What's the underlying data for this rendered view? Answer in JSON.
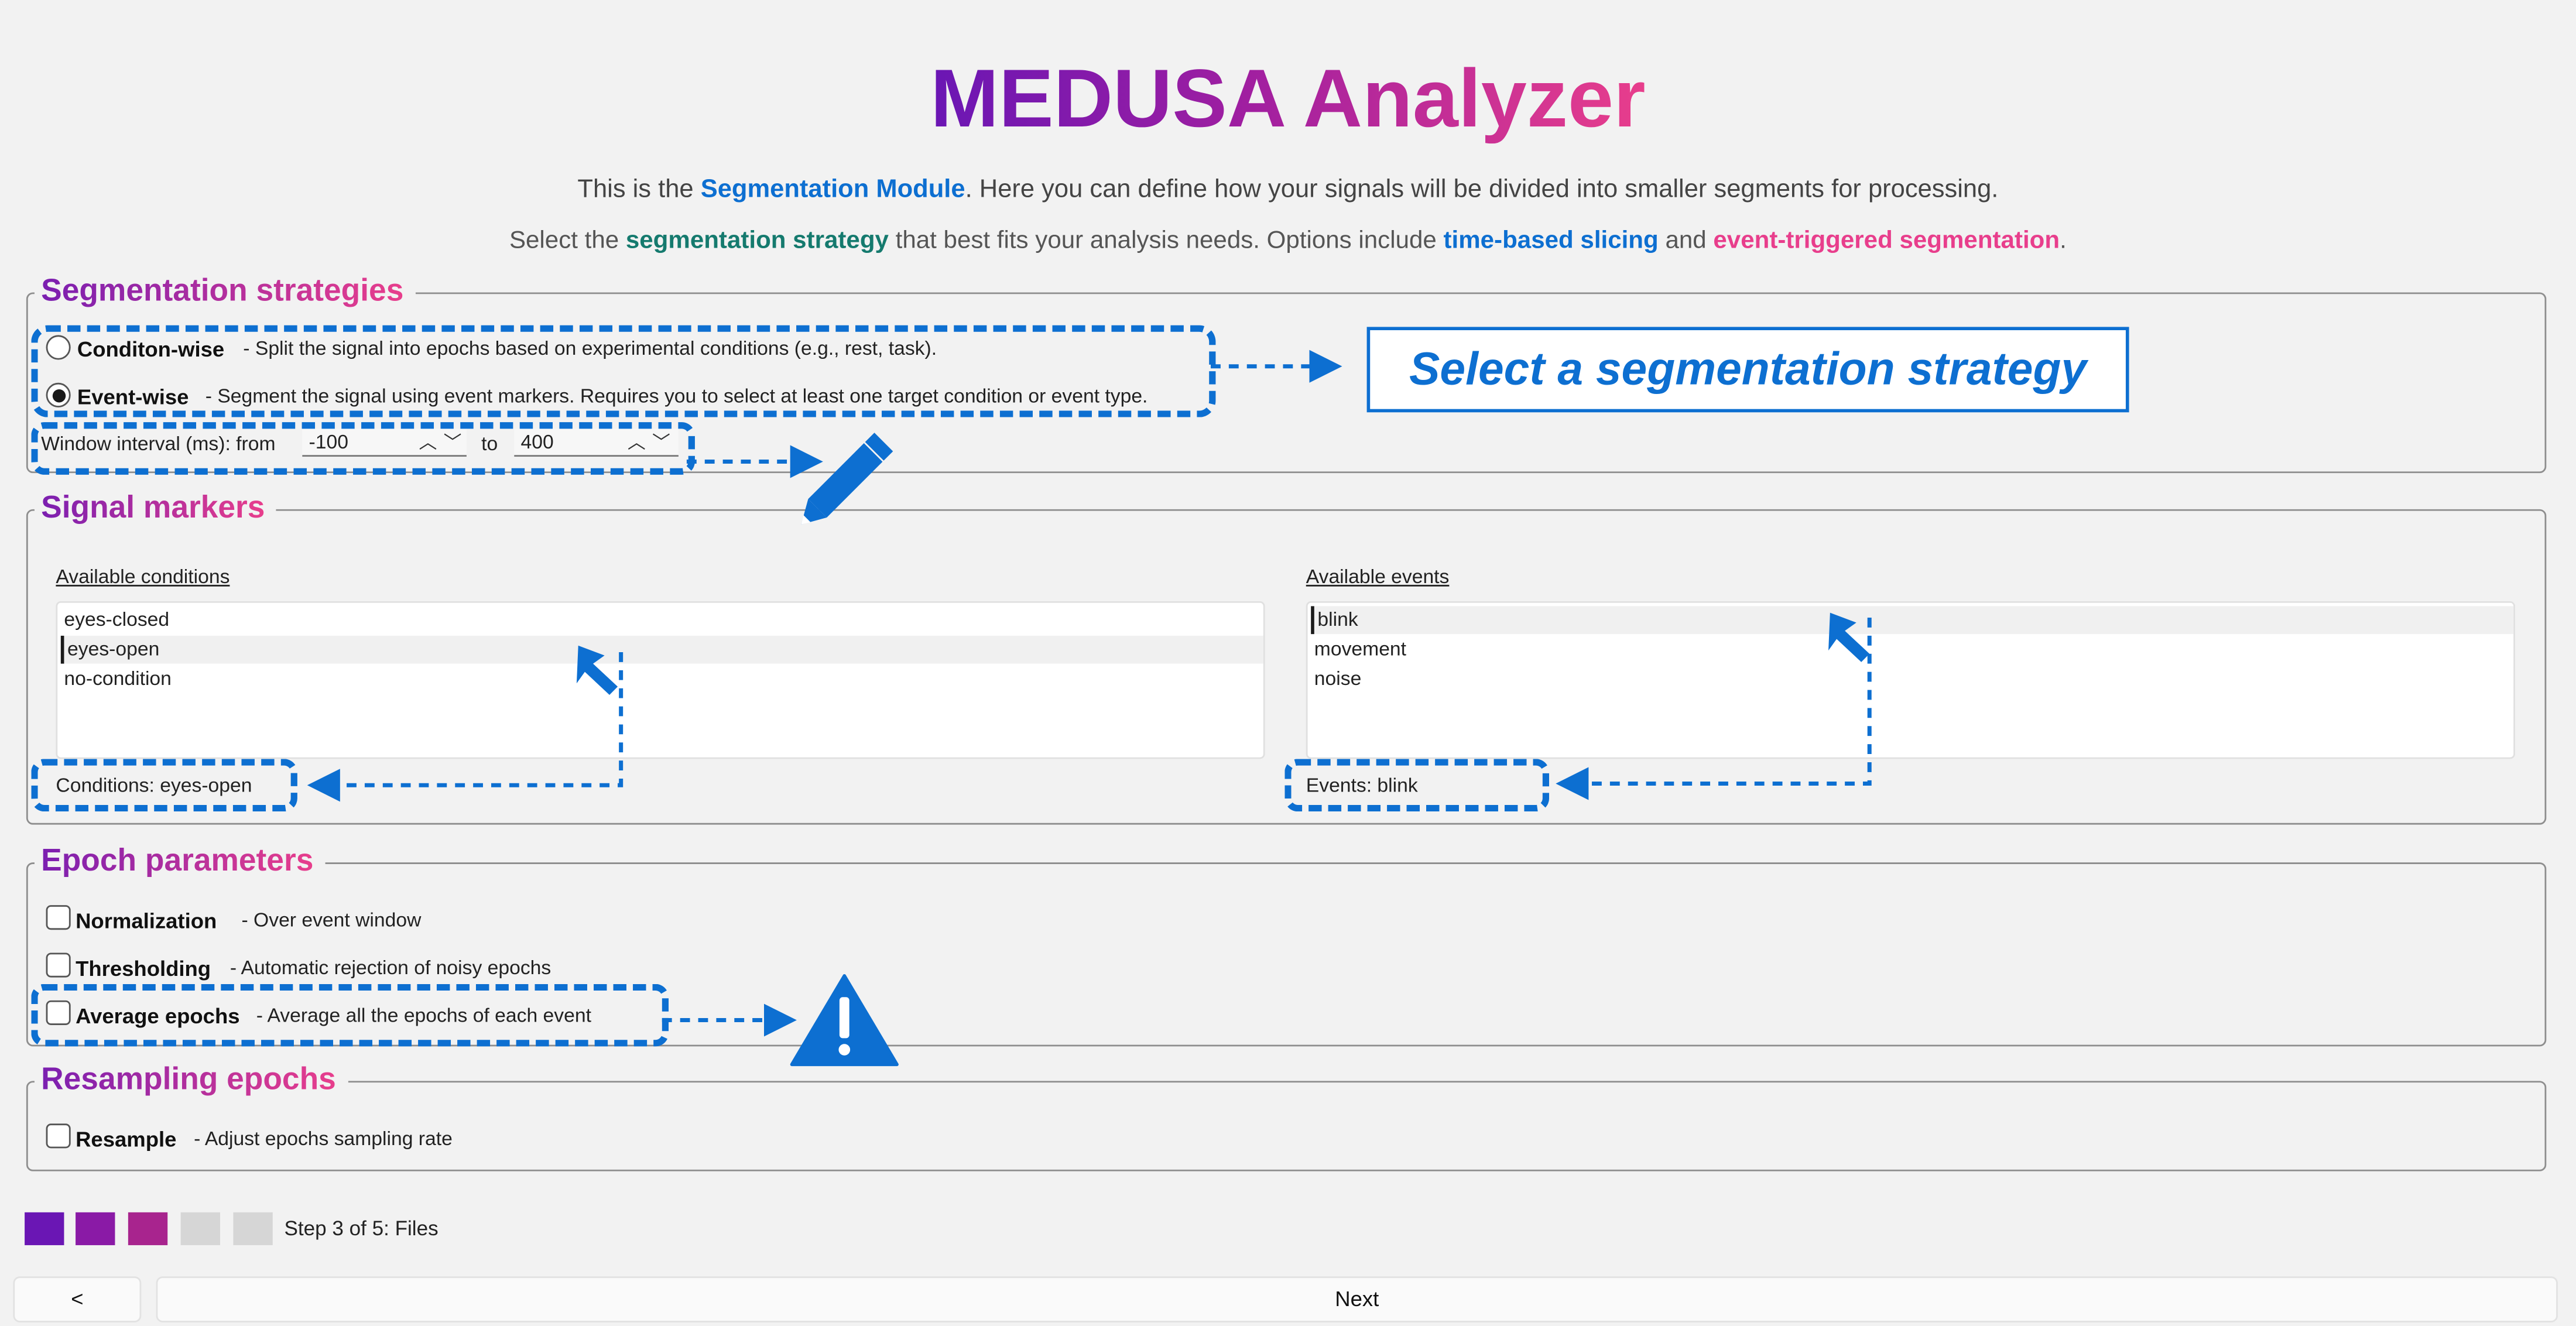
{
  "app": {
    "title": "MEDUSA Analyzer"
  },
  "intro": {
    "line1_pre": "This is the ",
    "line1_kw": "Segmentation Module",
    "line1_post": ". Here you can define how your signals will be divided into smaller segments for processing.",
    "line2_pre": "Select the ",
    "line2_kw1": "segmentation strategy",
    "line2_mid1": " that best fits your analysis needs. Options include ",
    "line2_kw2": "time-based slicing",
    "line2_mid2": " and ",
    "line2_kw3": "event-triggered segmentation",
    "line2_post": "."
  },
  "strategies": {
    "legend": "Segmentation strategies",
    "condition": {
      "name": "Conditon-wise",
      "desc": "- Split the signal into epochs  based on experimental conditions (e.g., rest, task).",
      "checked": false
    },
    "event": {
      "name": "Event-wise",
      "desc": "- Segment the signal using event markers.  Requires you to select at least one target condition or event type.",
      "checked": true
    },
    "window": {
      "label": "Window interval (ms): from",
      "from": "-100",
      "to_label": "to",
      "to": "400"
    }
  },
  "markers": {
    "legend": "Signal markers",
    "conditions_label": "Available conditions",
    "conditions": [
      "eyes-closed",
      "eyes-open",
      "no-condition"
    ],
    "conditions_selected": "eyes-open",
    "conditions_status": "Conditions: eyes-open",
    "events_label": "Available events",
    "events": [
      "blink",
      "movement",
      "noise"
    ],
    "events_selected": "blink",
    "events_status": "Events: blink"
  },
  "epoch": {
    "legend": "Epoch parameters",
    "normalization": {
      "name": "Normalization",
      "desc": "- Over event window"
    },
    "thresholding": {
      "name": "Thresholding",
      "desc": "- Automatic rejection of noisy epochs"
    },
    "average": {
      "name": "Average epochs",
      "desc": "- Average all the epochs of each event"
    }
  },
  "resampling": {
    "legend": "Resampling epochs",
    "resample": {
      "name": "Resample",
      "desc": "- Adjust epochs sampling rate"
    }
  },
  "annotation": {
    "callout": "Select a segmentation strategy",
    "icons": [
      "pencil-icon",
      "warning-icon"
    ]
  },
  "steps": {
    "text": "Step 3 of 5: Files",
    "current": 3,
    "total": 5,
    "colors": [
      "#6a16b4",
      "#8a1aa6",
      "#a8248e",
      "#d6d6d6",
      "#d6d6d6"
    ]
  },
  "nav": {
    "back": "<",
    "next": "Next"
  },
  "colors": {
    "accent_blue": "#0d6fd1",
    "teal": "#157a6e",
    "pink": "#e83e8c",
    "purple": "#6a16b4"
  }
}
